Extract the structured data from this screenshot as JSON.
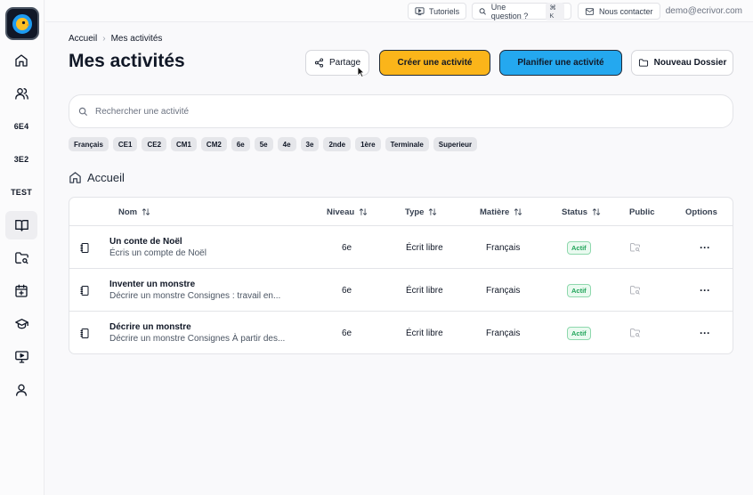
{
  "sidebar": {
    "items": [
      {
        "icon": "home-icon"
      },
      {
        "icon": "users-icon"
      },
      {
        "label": "6E4"
      },
      {
        "label": "3E2"
      },
      {
        "label": "TEST"
      },
      {
        "icon": "book-open-icon"
      },
      {
        "icon": "folder-search-icon"
      },
      {
        "icon": "calendar-plus-icon"
      },
      {
        "icon": "graduation-cap-icon"
      },
      {
        "icon": "presentation-icon"
      },
      {
        "icon": "user-icon"
      }
    ]
  },
  "topbar": {
    "tutorials_label": "Tutoriels",
    "question_label": "Une question ?",
    "question_shortcut": "⌘ K",
    "contact_label": "Nous contacter",
    "user_email": "demo@ecrivor.com"
  },
  "breadcrumb": {
    "root": "Accueil",
    "current": "Mes activités"
  },
  "page_title": "Mes activités",
  "actions": {
    "share_label": "Partage",
    "create_label": "Créer une activité",
    "plan_label": "Planifier une activité",
    "new_folder_label": "Nouveau Dossier"
  },
  "colors": {
    "create": "#fbb51a",
    "plan": "#24a8ef",
    "status_active": "#22a55b"
  },
  "search": {
    "placeholder": "Rechercher une activité",
    "value": ""
  },
  "filters": [
    "Français",
    "CE1",
    "CE2",
    "CM1",
    "CM2",
    "6e",
    "5e",
    "4e",
    "3e",
    "2nde",
    "1ère",
    "Terminale",
    "Superieur"
  ],
  "folder": {
    "label": "Accueil"
  },
  "table": {
    "headers": {
      "name": "Nom",
      "level": "Niveau",
      "type": "Type",
      "subject": "Matière",
      "status": "Status",
      "public": "Public",
      "options": "Options"
    },
    "rows": [
      {
        "title": "Un conte de Noël",
        "desc": "Écris un compte de Noël",
        "level": "6e",
        "type": "Écrit libre",
        "subject": "Français",
        "status": "Actif"
      },
      {
        "title": "Inventer un monstre",
        "desc": "Décrire un monstre Consignes : travail en...",
        "level": "6e",
        "type": "Écrit libre",
        "subject": "Français",
        "status": "Actif"
      },
      {
        "title": "Décrire un monstre",
        "desc": "Décrire un monstre Consignes À partir des...",
        "level": "6e",
        "type": "Écrit libre",
        "subject": "Français",
        "status": "Actif"
      }
    ]
  }
}
